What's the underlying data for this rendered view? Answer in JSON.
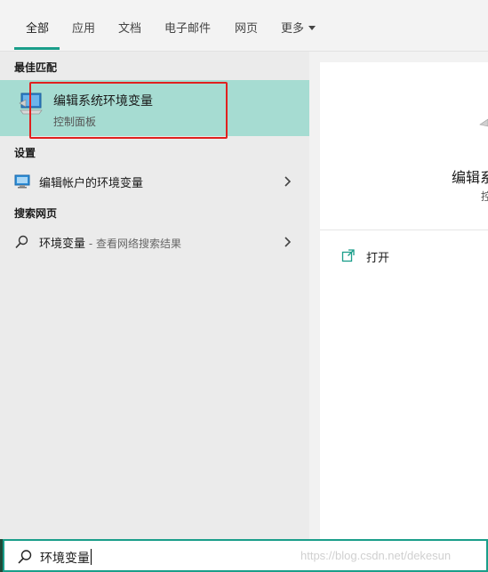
{
  "tabs": [
    {
      "label": "全部",
      "active": true
    },
    {
      "label": "应用"
    },
    {
      "label": "文档"
    },
    {
      "label": "电子邮件"
    },
    {
      "label": "网页"
    },
    {
      "label": "更多"
    }
  ],
  "sections": {
    "best_match": "最佳匹配",
    "settings": "设置",
    "search_web": "搜索网页"
  },
  "best_match": {
    "title": "编辑系统环境变量",
    "subtitle": "控制面板",
    "icon": "monitor-icon"
  },
  "settings_items": [
    {
      "label": "编辑帐户的环境变量",
      "icon": "settings-monitor-icon"
    }
  ],
  "web_items": [
    {
      "label": "环境变量",
      "hint": " - 查看网络搜索结果",
      "icon": "search-icon"
    }
  ],
  "detail": {
    "title": "编辑系",
    "subtitle": "控",
    "actions": [
      {
        "label": "打开",
        "icon": "open-icon"
      }
    ]
  },
  "search": {
    "value": "环境变量",
    "icon": "search-icon"
  },
  "watermark": "https://blog.csdn.net/dekesun",
  "colors": {
    "accent": "#1a9e8a",
    "highlight": "#a6dcd2",
    "annotation": "#e0201e"
  }
}
